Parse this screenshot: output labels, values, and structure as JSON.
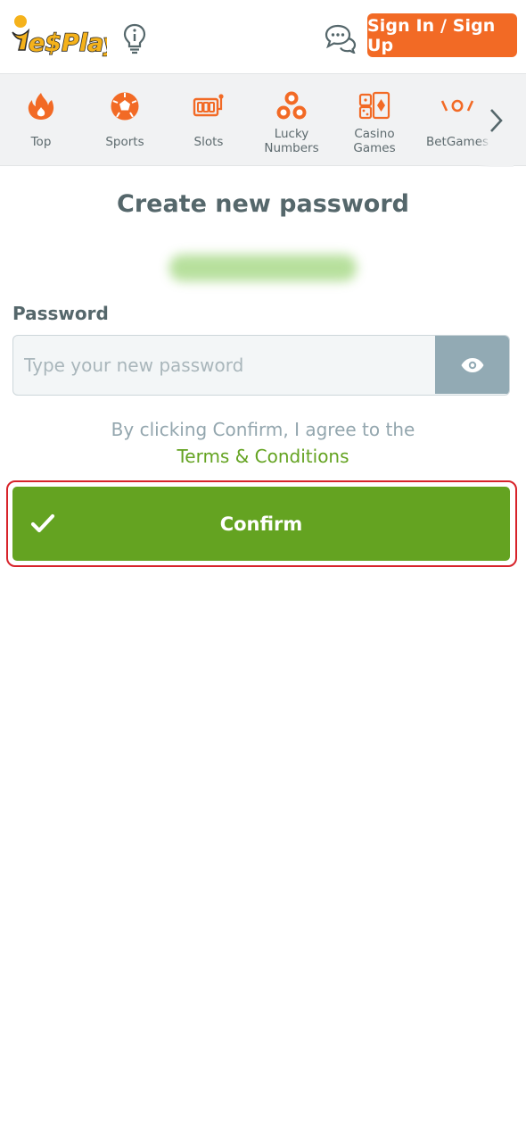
{
  "header": {
    "logo_text": "YesPlay",
    "info_icon": "lightbulb-info-icon",
    "chat_icon": "chat-bubbles-icon",
    "signin_label": "Sign In / Sign Up",
    "accent_color": "#f26a25"
  },
  "categories": [
    {
      "label": "Top",
      "icon": "flame-icon"
    },
    {
      "label": "Sports",
      "icon": "soccer-ball-icon"
    },
    {
      "label": "Slots",
      "icon": "slot-machine-icon"
    },
    {
      "label": "Lucky\nNumbers",
      "icon": "lottery-balls-icon"
    },
    {
      "label": "Casino\nGames",
      "icon": "dice-cards-icon"
    },
    {
      "label": "BetGames",
      "icon": "betgames-icon"
    }
  ],
  "main": {
    "title": "Create new password",
    "password_label": "Password",
    "password_placeholder": "Type your new password",
    "password_value": "",
    "agree_text": "By clicking Confirm, I agree to the",
    "terms_link": "Terms & Conditions",
    "confirm_label": "Confirm",
    "confirm_color": "#64a321"
  }
}
